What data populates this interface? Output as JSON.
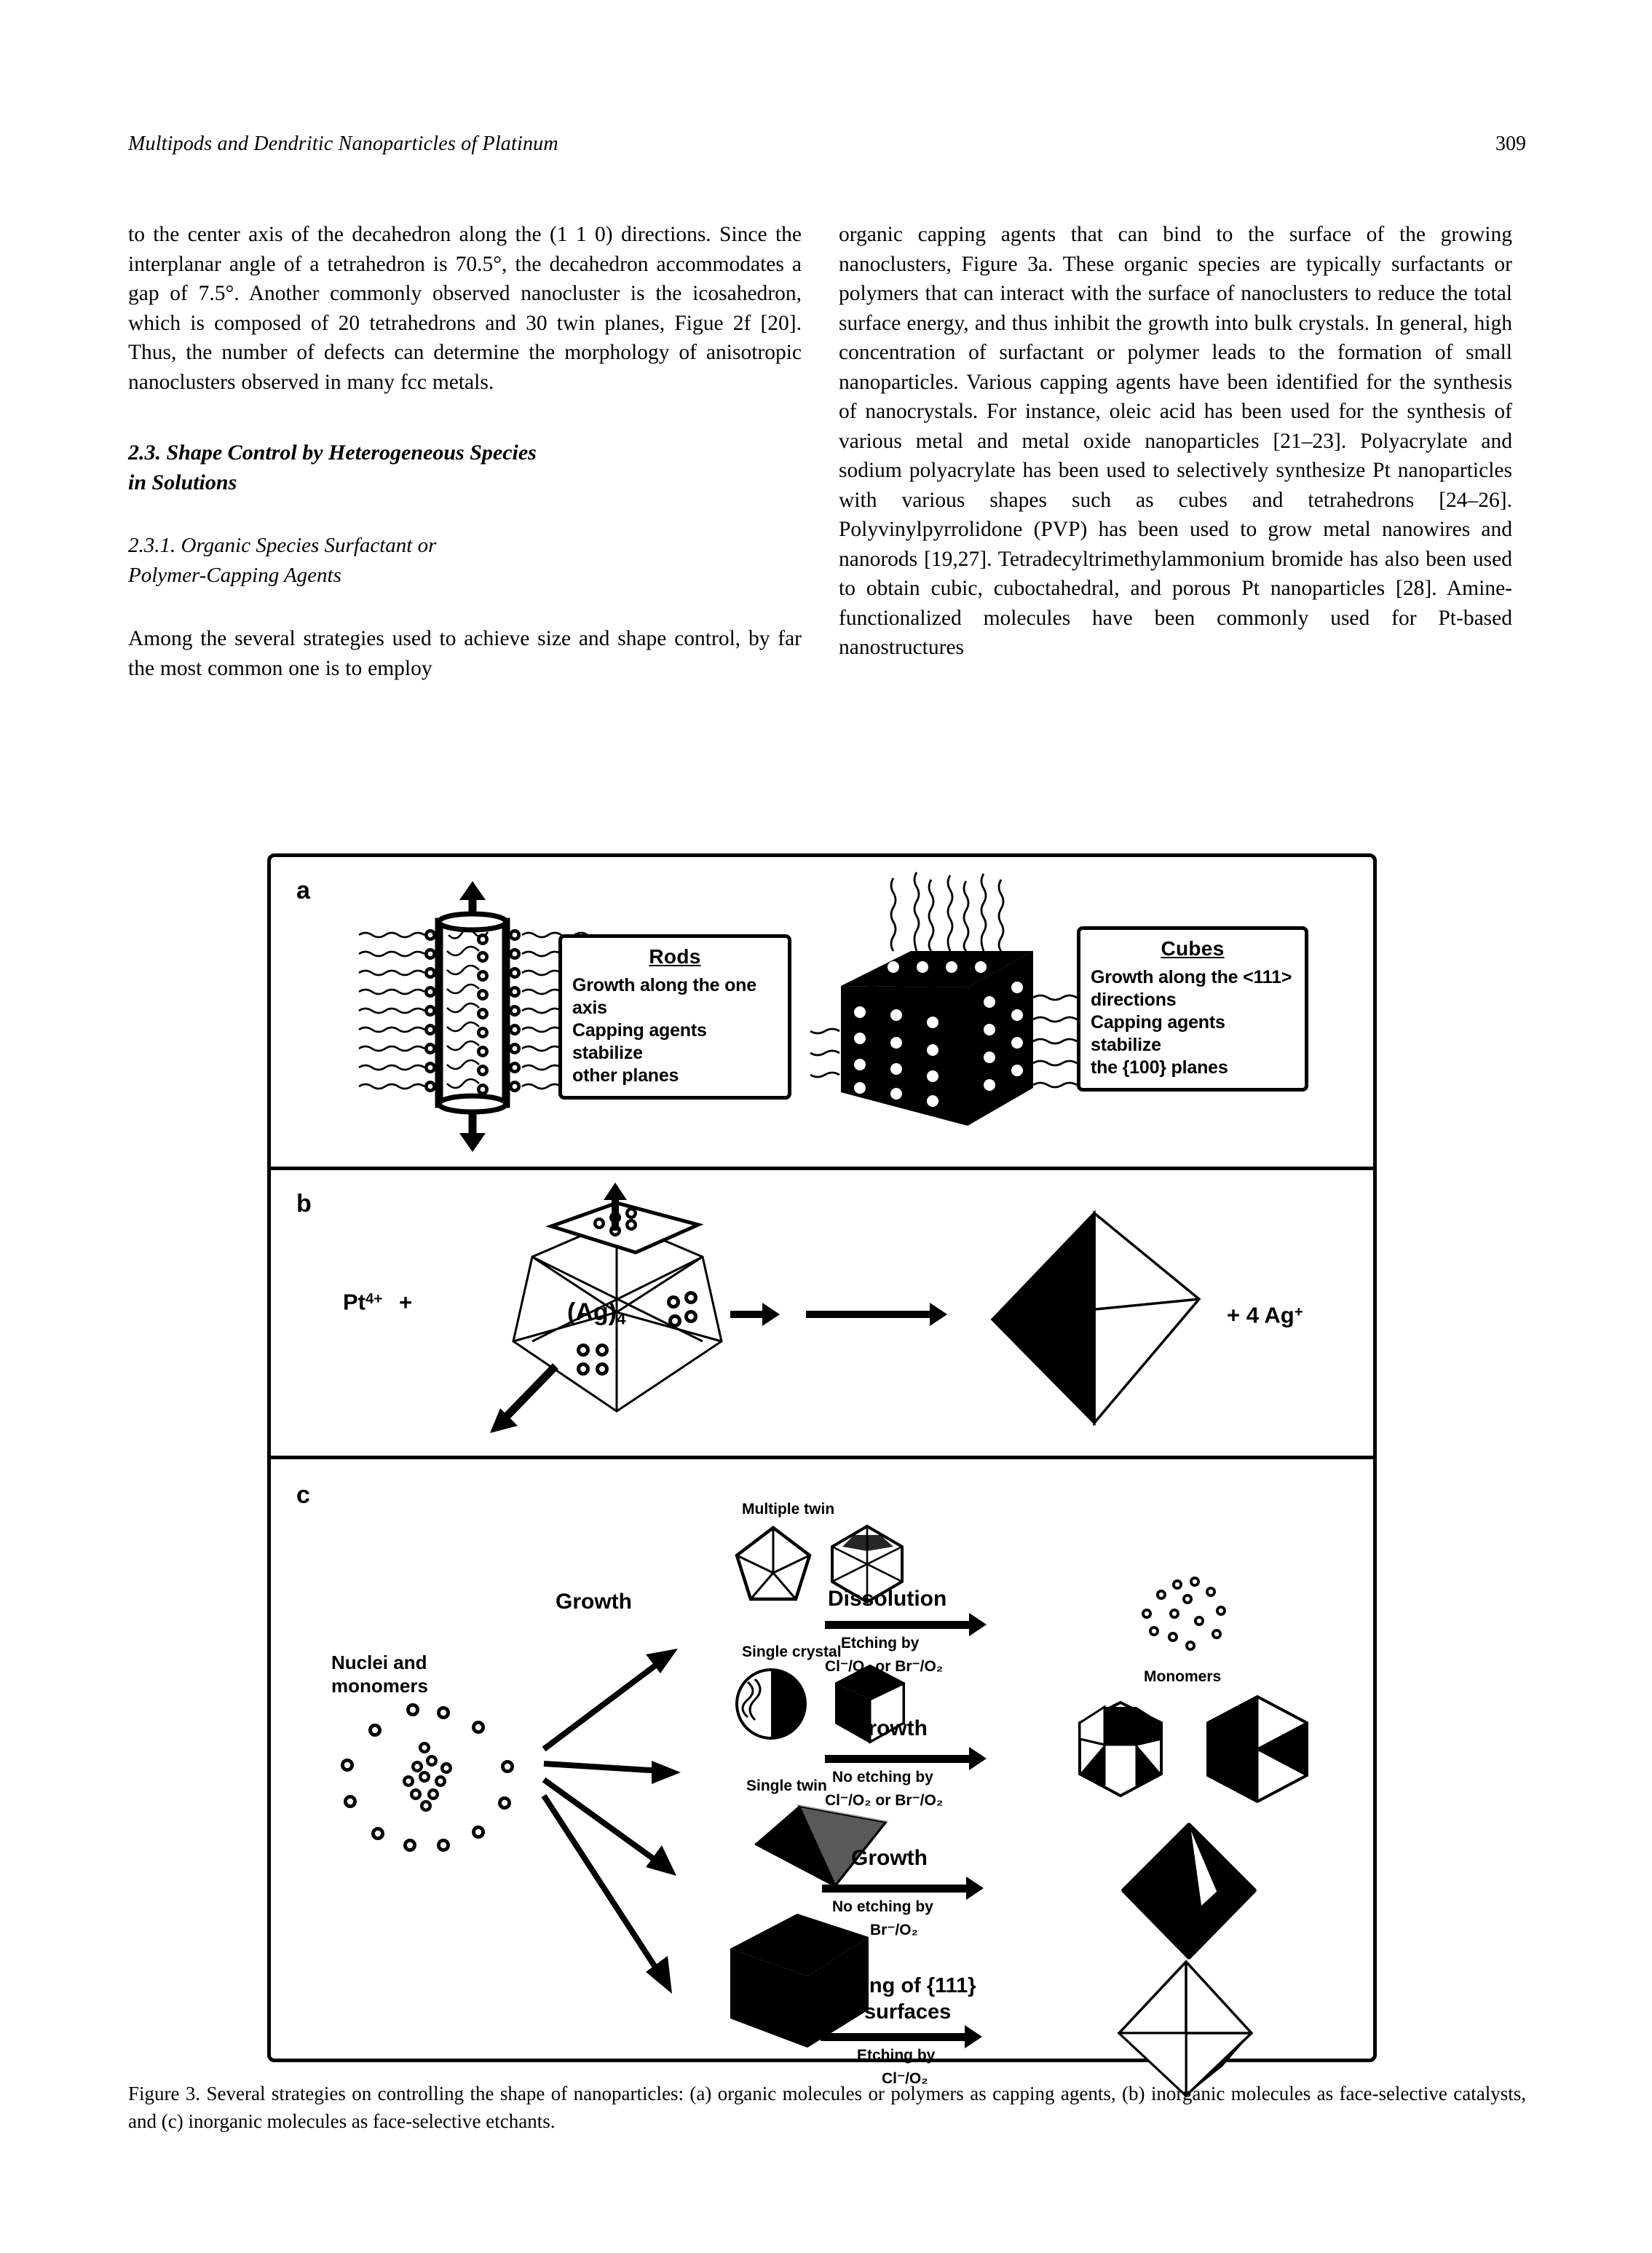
{
  "running_head": {
    "title": "Multipods and Dendritic Nanoparticles of Platinum",
    "page_number": "309"
  },
  "left_column": {
    "para1": "to the center axis of the decahedron along the (1 1 0) directions. Since the interplanar angle of a tetrahedron is 70.5°, the decahedron accommodates a gap of 7.5°. Another commonly observed nanocluster is the icosahedron, which is composed of 20 tetrahedrons and 30 twin planes, Figue 2f [20]. Thus, the number of defects can determine the morphology of anisotropic nanoclusters observed in many fcc metals.",
    "heading_2_3_line1": "2.3.  Shape Control by Heterogeneous Species",
    "heading_2_3_line2": "in Solutions",
    "heading_2_3_1_line1": "2.3.1.  Organic Species Surfactant or",
    "heading_2_3_1_line2": "Polymer-Capping Agents",
    "para2": "Among the several strategies used to achieve size and shape control, by far the most common one is to employ"
  },
  "right_column": {
    "para1": "organic capping agents that can bind to the surface of the growing nanoclusters, Figure 3a. These organic species are typically surfactants or polymers that can interact with the surface of nanoclusters to reduce the total surface energy, and thus inhibit the growth into bulk crystals. In general, high concentration of surfactant or polymer leads to the formation of small nanoparticles. Various capping agents have been identified for the synthesis of nanocrystals. For instance, oleic acid has been used for the synthesis of various metal and metal oxide nanoparticles [21–23]. Polyacrylate and sodium polyacrylate has been used to selectively synthesize Pt nanoparticles with various shapes such as cubes and tetrahedrons [24–26]. Polyvinylpyrrolidone (PVP) has been used to grow metal nanowires and nanorods [19,27]. Tetradecyltrimethylammonium bromide has also been used to obtain cubic, cuboctahedral, and porous Pt nanoparticles [28]. Amine-functionalized molecules have been commonly used for Pt-based nanostructures"
  },
  "figure": {
    "panel_a": {
      "letter": "a",
      "rods_box": {
        "title": "Rods",
        "lines": [
          "Growth along the one axis",
          "Capping agents stabilize",
          "other planes"
        ]
      },
      "cubes_box": {
        "title": "Cubes",
        "lines": [
          "Growth along the <111>",
          "directions",
          "Capping agents stabilize",
          "the {100} planes"
        ]
      }
    },
    "panel_b": {
      "letter": "b",
      "reactant": "Pt",
      "reactant_charge": "4+",
      "plus": "+",
      "cluster_label": "(Ag)",
      "cluster_sub": "4",
      "product": "+ 4 Ag",
      "product_charge": "+"
    },
    "panel_c": {
      "letter": "c",
      "source_label_line1": "Nuclei and",
      "source_label_line2": "monomers",
      "growth_arrow_label": "Growth",
      "branch_titles": {
        "multiple_twin": "Multiple twin",
        "single_crystal": "Single crystal",
        "single_twin": "Single twin"
      },
      "routes": [
        {
          "above": "Dissolution",
          "below_line1": "Etching by",
          "below_line2": "Cl⁻/O₂ or Br⁻/O₂",
          "product_label": "Monomers"
        },
        {
          "above": "Growth",
          "below_line1": "No etching by",
          "below_line2": "Cl⁻/O₂ or Br⁻/O₂",
          "product_label": ""
        },
        {
          "above": "Growth",
          "below_line1": "No etching by",
          "below_line2": "Br⁻/O₂",
          "product_label": ""
        },
        {
          "above_line1": "Etching of {111}",
          "above_line2": "surfaces",
          "below_line1": "Etching by",
          "below_line2": "Cl⁻/O₂",
          "product_label": ""
        }
      ]
    }
  },
  "caption": "Figure 3.   Several strategies on controlling the shape of nanoparticles: (a) organic molecules or polymers as capping agents, (b) inorganic molecules as face-selective catalysts, and (c) inorganic molecules as face-selective etchants.",
  "colors": {
    "ink": "#000000",
    "paper": "#ffffff"
  }
}
